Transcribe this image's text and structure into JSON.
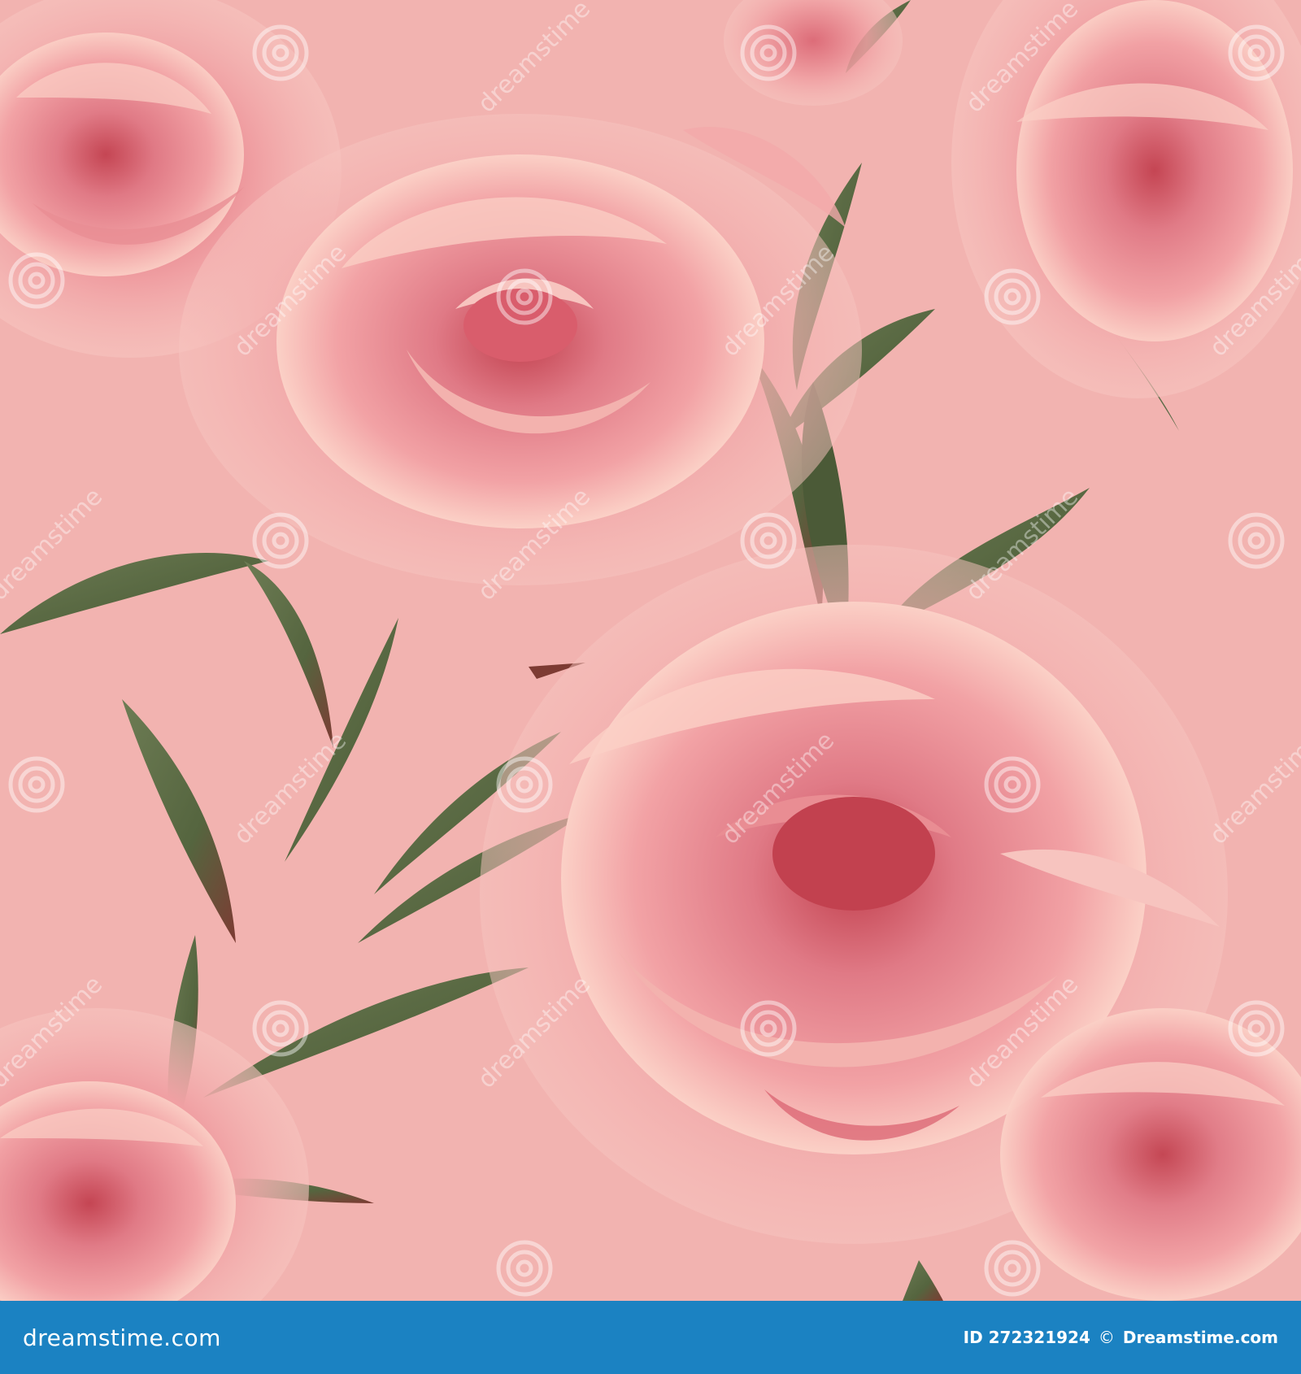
{
  "image": {
    "subject": "seamless pink peony pattern",
    "colors": {
      "background": "#f2b3b0",
      "petal_light": "#f7c2bd",
      "petal_mid": "#ee979a",
      "petal_dark": "#d95d6c",
      "petal_deep": "#c2414f",
      "petal_highlight": "#fbd6c8",
      "leaf": "#5a6b47",
      "leaf_dark": "#3f4a2f",
      "leaf_vein": "#7d3b33"
    }
  },
  "watermark": {
    "text": "dreamstime",
    "spiral_icon": "spiral-icon"
  },
  "footer": {
    "background": "#1b82c2",
    "logo": "dreamstime.com",
    "id_label": "ID 272321924",
    "copyright": "©",
    "brand": "Dreamstime.com"
  }
}
